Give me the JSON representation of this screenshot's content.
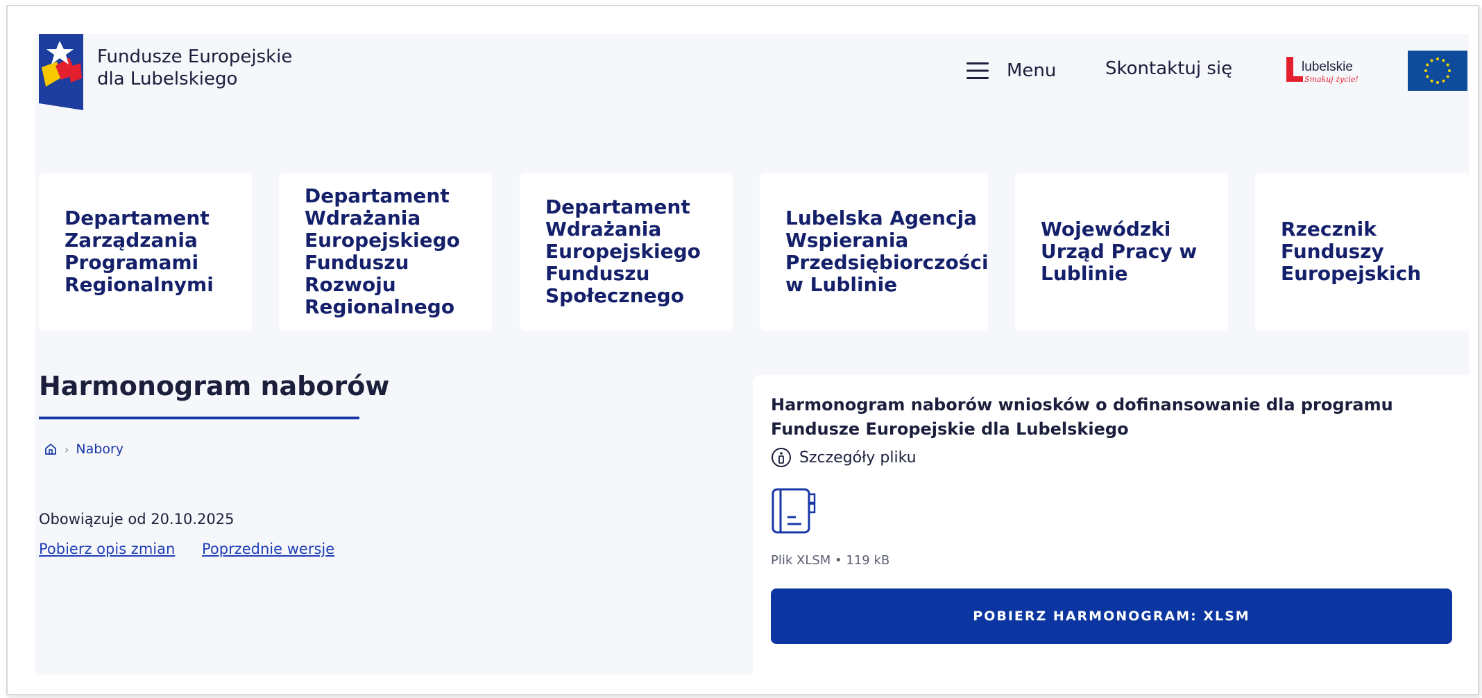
{
  "header": {
    "brand_line1": "Fundusze Europejskie",
    "brand_line2": "dla Lubelskiego",
    "menu_label": "Menu",
    "contact_label": "Skontaktuj się",
    "region_logo_word": "lubelskie",
    "region_logo_tagline": "Smakuj życie!"
  },
  "cards": [
    {
      "label": "Departament\nZarządzania\nProgramami\nRegionalnymi"
    },
    {
      "label": "Departament\nWdrażania\nEuropejskiego\nFunduszu\nRozwoju\nRegionalnego"
    },
    {
      "label": "Departament\nWdrażania\nEuropejskiego\nFunduszu\nSpołecznego"
    },
    {
      "label": "Lubelska Agencja\nWspierania\nPrzedsiębiorczości\nw Lublinie"
    },
    {
      "label": "Wojewódzki\nUrząd Pracy w\nLublinie"
    },
    {
      "label": "Rzecznik\nFunduszy\nEuropejskich"
    }
  ],
  "main": {
    "title": "Harmonogram naborów",
    "breadcrumb_current": "Nabory",
    "valid_from": "Obowiązuje od 20.10.2025",
    "link_changes": "Pobierz opis zmian",
    "link_versions": "Poprzednie wersje"
  },
  "file_panel": {
    "title": "Harmonogram naborów wniosków o dofinansowanie dla programu Fundusze Europejskie dla Lubelskiego",
    "details_label": "Szczegóły pliku",
    "file_meta": "Plik XLSM • 119 kB",
    "download_label": "POBIERZ HARMONOGRAM: XLSM"
  },
  "colors": {
    "primary": "#0b35a0",
    "card_text": "#15206b",
    "page_bg": "#f6f7fb"
  },
  "icons": [
    "eu-funds-logo-icon",
    "hamburger-icon",
    "home-icon",
    "chevron-right-icon",
    "info-icon",
    "file-icon",
    "eu-flag-icon"
  ]
}
